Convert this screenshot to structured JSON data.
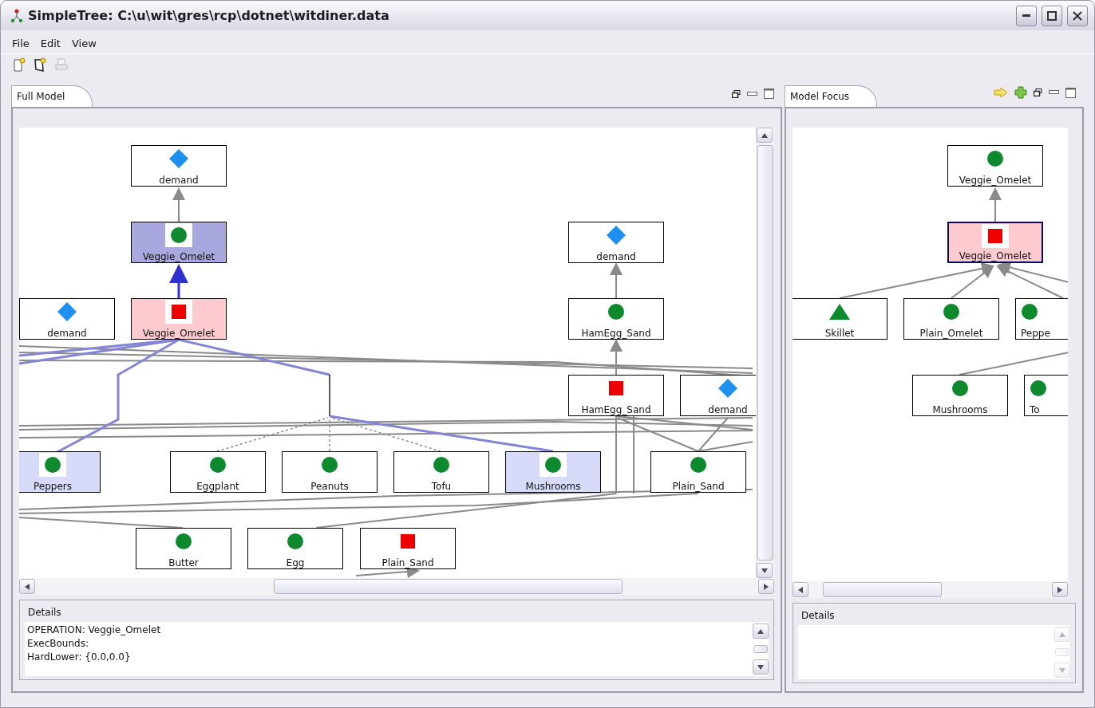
{
  "window": {
    "title": "SimpleTree: C:\\u\\wit\\gres\\rcp\\dotnet\\witdiner.data"
  },
  "menu": [
    "File",
    "Edit",
    "View"
  ],
  "toolbar": [
    {
      "kind": "new",
      "disabled": false
    },
    {
      "kind": "new_alt",
      "disabled": false
    },
    {
      "kind": "print",
      "disabled": true
    }
  ],
  "full_model": {
    "tab": "Full Model",
    "nodes": [
      {
        "label": "demand",
        "kind": "diamond",
        "color": "#ffffff",
        "selected": false
      },
      {
        "label": "Veggie_Omelet",
        "kind": "circle",
        "color": "#a8a8de",
        "selected": false
      },
      {
        "label": "demand",
        "kind": "diamond",
        "color": "#ffffff",
        "selected": false
      },
      {
        "label": "Veggie_Omelet",
        "kind": "square",
        "color": "#fdcbcf",
        "selected": false
      },
      {
        "label": "demand",
        "kind": "diamond",
        "color": "#ffffff",
        "selected": false
      },
      {
        "label": "HamEgg_Sand",
        "kind": "circle",
        "color": "#ffffff",
        "selected": false
      },
      {
        "label": "HamEgg_Sand",
        "kind": "square",
        "color": "#ffffff",
        "selected": false
      },
      {
        "label": "demand",
        "kind": "diamond",
        "color": "#ffffff",
        "selected": false
      },
      {
        "label": "Peppers",
        "kind": "circle",
        "color": "#d8dafa",
        "selected": false
      },
      {
        "label": "Eggplant",
        "kind": "circle",
        "color": "#ffffff",
        "selected": false
      },
      {
        "label": "Peanuts",
        "kind": "circle",
        "color": "#ffffff",
        "selected": false
      },
      {
        "label": "Tofu",
        "kind": "circle",
        "color": "#ffffff",
        "selected": false
      },
      {
        "label": "Mushrooms",
        "kind": "circle",
        "color": "#d8dafa",
        "selected": false
      },
      {
        "label": "Plain_Sand",
        "kind": "circle",
        "color": "#ffffff",
        "selected": false
      },
      {
        "label": "Butter",
        "kind": "circle",
        "color": "#ffffff",
        "selected": false
      },
      {
        "label": "Egg",
        "kind": "circle",
        "color": "#ffffff",
        "selected": false
      },
      {
        "label": "Plain_Sand",
        "kind": "square",
        "color": "#ffffff",
        "selected": false
      }
    ],
    "details": {
      "label": "Details",
      "lines": [
        "OPERATION: Veggie_Omelet",
        "ExecBounds:",
        "HardLower: {0.0,0.0}"
      ],
      "scroll_disabled": false
    }
  },
  "model_focus": {
    "tab": "Model Focus",
    "nodes": [
      {
        "label": "Veggie_Omelet",
        "kind": "circle",
        "color": "#ffffff",
        "selected": false
      },
      {
        "label": "Veggie_Omelet",
        "kind": "square",
        "color": "#fdcbcf",
        "selected": true
      },
      {
        "label": "Skillet",
        "kind": "triangle",
        "color": "#ffffff",
        "selected": false
      },
      {
        "label": "Plain_Omelet",
        "kind": "circle",
        "color": "#ffffff",
        "selected": false
      },
      {
        "label": "Peppe",
        "kind": "circle",
        "color": "#ffffff",
        "selected": false
      },
      {
        "label": "Mushrooms",
        "kind": "circle",
        "color": "#ffffff",
        "selected": false
      },
      {
        "label": "To",
        "kind": "circle",
        "color": "#ffffff",
        "selected": false
      }
    ],
    "details": {
      "label": "Details",
      "scroll_disabled": true
    }
  }
}
